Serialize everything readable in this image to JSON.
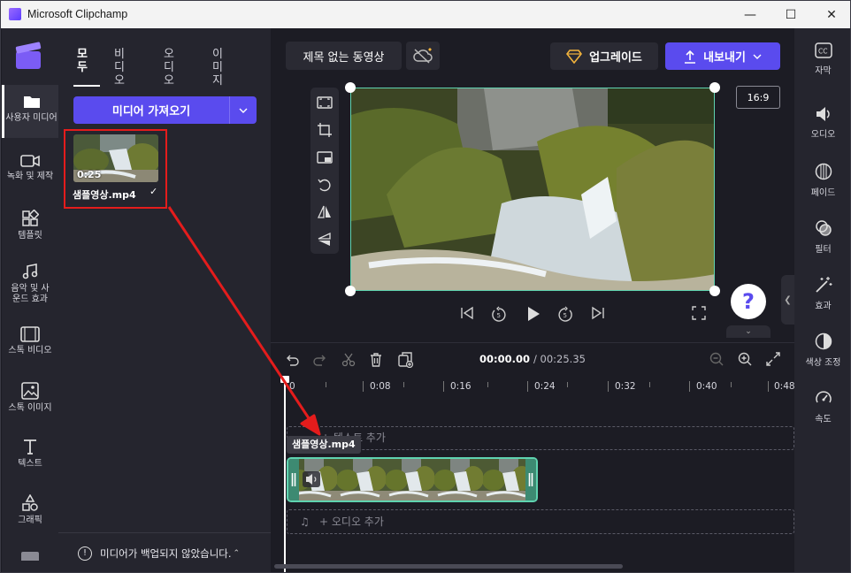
{
  "window": {
    "title": "Microsoft Clipchamp",
    "controls": [
      "minimize",
      "maximize",
      "close"
    ]
  },
  "left_rail": {
    "items": [
      {
        "label": "사용자 미디어",
        "icon": "folder-icon",
        "active": true
      },
      {
        "label": "녹화 및 제작",
        "icon": "camera-icon"
      },
      {
        "label": "템플릿",
        "icon": "templates-icon"
      },
      {
        "label": "음악 및 사운드 효과",
        "icon": "music-icon"
      },
      {
        "label": "스톡 비디오",
        "icon": "film-icon"
      },
      {
        "label": "스톡 이미지",
        "icon": "image-icon"
      },
      {
        "label": "텍스트",
        "icon": "text-icon"
      },
      {
        "label": "그래픽",
        "icon": "shapes-icon"
      }
    ]
  },
  "media_panel": {
    "tabs": [
      "모두",
      "비디오",
      "오디오",
      "이미지"
    ],
    "import_label": "미디어 가져오기",
    "item": {
      "name": "샘플영상.mp4",
      "duration": "0:25"
    },
    "backup_notice": "미디어가 백업되지 않았습니다."
  },
  "editor": {
    "project_title": "제목 없는 동영상",
    "upgrade_label": "업그레이드",
    "export_label": "내보내기",
    "aspect_ratio": "16:9",
    "help_label": "?"
  },
  "right_rail": {
    "items": [
      {
        "label": "자막",
        "icon": "captions-icon"
      },
      {
        "label": "오디오",
        "icon": "speaker-icon"
      },
      {
        "label": "페이드",
        "icon": "fade-icon"
      },
      {
        "label": "필터",
        "icon": "filter-icon"
      },
      {
        "label": "효과",
        "icon": "magic-wand-icon"
      },
      {
        "label": "색상 조정",
        "icon": "color-adjust-icon"
      },
      {
        "label": "속도",
        "icon": "speedometer-icon"
      }
    ]
  },
  "timeline": {
    "current_time": "00:00.00",
    "total_time": "/ 00:25.35",
    "ruler_labels": [
      "0",
      "0:08",
      "0:16",
      "0:24",
      "0:32",
      "0:40",
      "0:48"
    ],
    "text_track_label": "+ 텍스트 추가",
    "audio_track_label": "+ 오디오 추가",
    "clip_label": "샘플영상.mp4"
  },
  "colors": {
    "accent": "#5a4bee",
    "selection": "#5fd3b0",
    "annotation": "#e41c1c"
  }
}
